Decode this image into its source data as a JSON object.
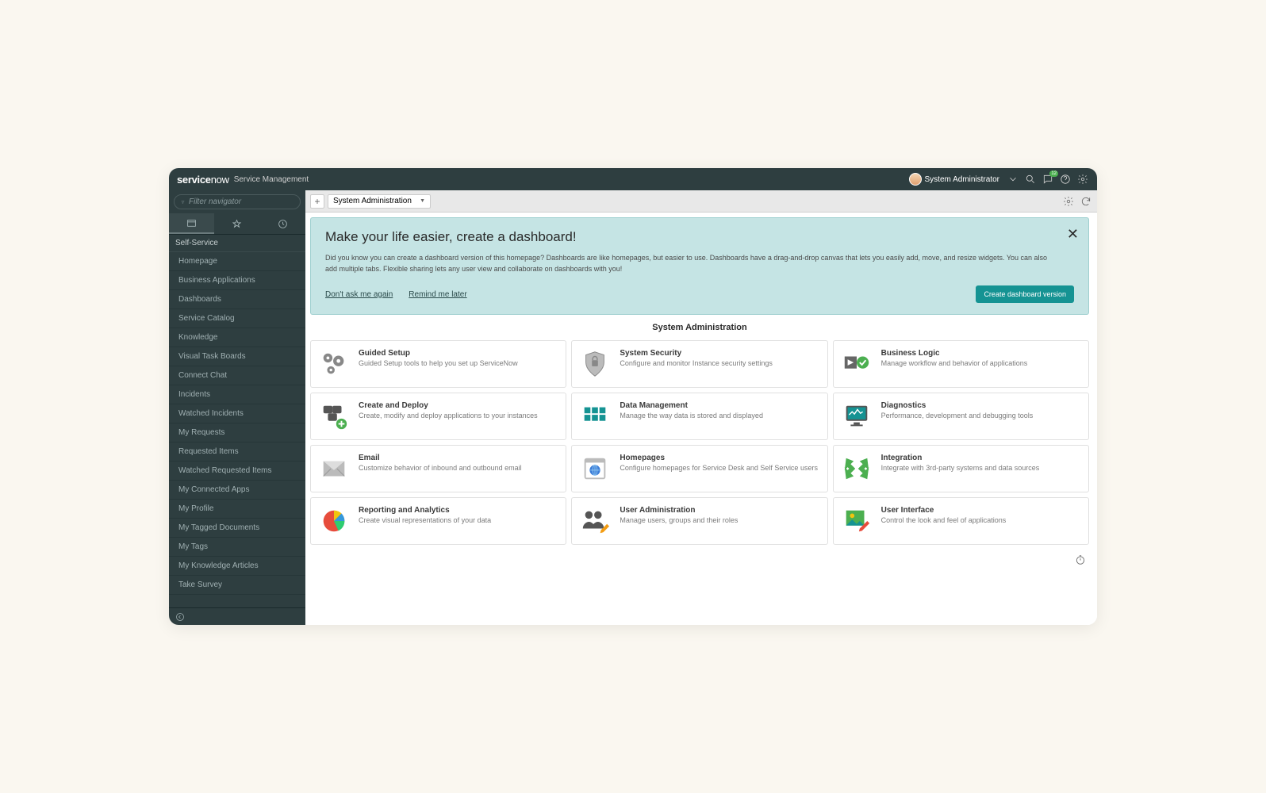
{
  "header": {
    "logo_main": "service",
    "logo_sub": "now",
    "app_name": "Service Management",
    "user": "System Administrator",
    "chat_badge": "12"
  },
  "sidebar": {
    "filter_placeholder": "Filter navigator",
    "section": "Self-Service",
    "items": [
      "Homepage",
      "Business Applications",
      "Dashboards",
      "Service Catalog",
      "Knowledge",
      "Visual Task Boards",
      "Connect Chat",
      "Incidents",
      "Watched Incidents",
      "My Requests",
      "Requested Items",
      "Watched Requested Items",
      "My Connected Apps",
      "My Profile",
      "My Tagged Documents",
      "My Tags",
      "My Knowledge Articles",
      "Take Survey"
    ]
  },
  "tab_bar": {
    "current": "System Administration"
  },
  "banner": {
    "title": "Make your life easier, create a dashboard!",
    "text": "Did you know you can create a dashboard version of this homepage? Dashboards are like homepages, but easier to use. Dashboards have a drag-and-drop canvas that lets you easily add, move, and resize widgets. You can also add multiple tabs. Flexible sharing lets any user view and collaborate on dashboards with you!",
    "link_dont": "Don't ask me again",
    "link_later": "Remind me later",
    "button": "Create dashboard version"
  },
  "page_title": "System Administration",
  "cards": [
    {
      "title": "Guided Setup",
      "desc": "Guided Setup tools to help you set up ServiceNow",
      "icon": "gears"
    },
    {
      "title": "System Security",
      "desc": "Configure and monitor Instance security settings",
      "icon": "shield"
    },
    {
      "title": "Business Logic",
      "desc": "Manage workflow and behavior of applications",
      "icon": "play-check"
    },
    {
      "title": "Create and Deploy",
      "desc": "Create, modify and deploy applications to your instances",
      "icon": "boxes-add"
    },
    {
      "title": "Data Management",
      "desc": "Manage the way data is stored and displayed",
      "icon": "grid"
    },
    {
      "title": "Diagnostics",
      "desc": "Performance, development and debugging tools",
      "icon": "monitor"
    },
    {
      "title": "Email",
      "desc": "Customize behavior of inbound and outbound email",
      "icon": "envelope"
    },
    {
      "title": "Homepages",
      "desc": "Configure homepages for Service Desk and Self Service users",
      "icon": "browser-globe"
    },
    {
      "title": "Integration",
      "desc": "Integrate with 3rd-party systems and data sources",
      "icon": "arrows-in"
    },
    {
      "title": "Reporting and Analytics",
      "desc": "Create visual representations of your data",
      "icon": "pie"
    },
    {
      "title": "User Administration",
      "desc": "Manage users, groups and their roles",
      "icon": "users-pencil"
    },
    {
      "title": "User Interface",
      "desc": "Control the look and feel of applications",
      "icon": "picture-brush"
    }
  ]
}
